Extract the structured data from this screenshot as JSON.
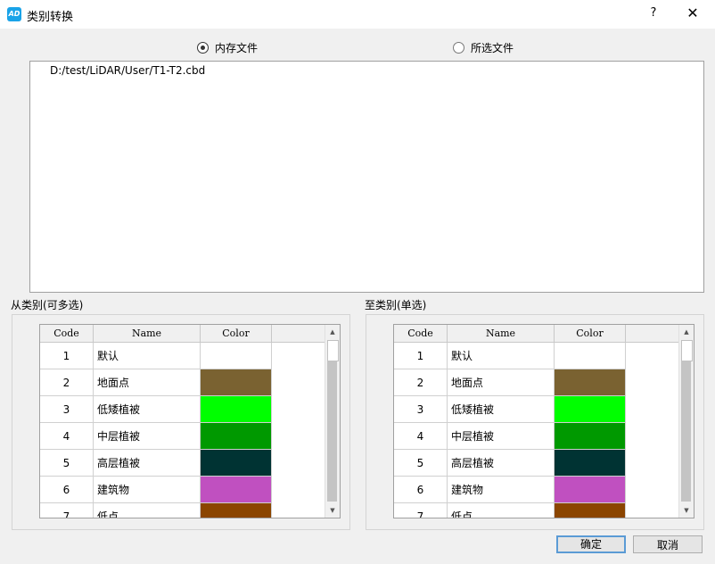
{
  "window": {
    "title": "类别转换",
    "icon_text": "AD",
    "help": "?",
    "close": "✕"
  },
  "mode": {
    "options": [
      {
        "label": "内存文件",
        "selected": true
      },
      {
        "label": "所选文件",
        "selected": false
      }
    ]
  },
  "files": [
    "D:/test/LiDAR/User/T1-T2.cbd"
  ],
  "from_group": {
    "label": "从类别(可多选)"
  },
  "to_group": {
    "label": "至类别(单选)"
  },
  "table": {
    "headers": [
      "Code",
      "Name",
      "Color"
    ],
    "rows": [
      {
        "code": "1",
        "name": "默认",
        "color": "#ffffff"
      },
      {
        "code": "2",
        "name": "地面点",
        "color": "#7a6231"
      },
      {
        "code": "3",
        "name": "低矮植被",
        "color": "#00ff00"
      },
      {
        "code": "4",
        "name": "中层植被",
        "color": "#009900"
      },
      {
        "code": "5",
        "name": "高层植被",
        "color": "#003333"
      },
      {
        "code": "6",
        "name": "建筑物",
        "color": "#c050c0"
      },
      {
        "code": "7",
        "name": "低点",
        "color": "#8b4500"
      }
    ]
  },
  "buttons": {
    "ok": "确定",
    "cancel": "取消"
  }
}
